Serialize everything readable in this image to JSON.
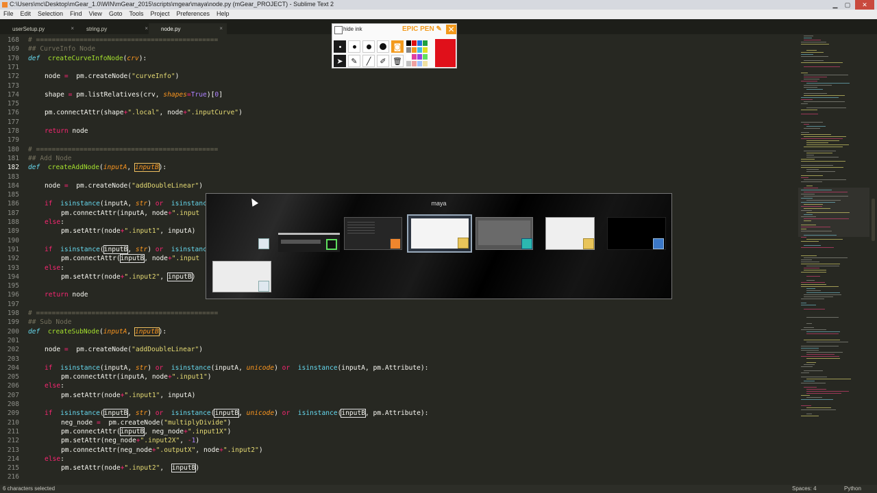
{
  "window": {
    "title": "C:\\Users\\mc\\Desktop\\mGear_1.0\\WIN\\mGear_2015\\scripts\\mgear\\maya\\node.py (mGear_PROJECT) - Sublime Text 2"
  },
  "menu": [
    "File",
    "Edit",
    "Selection",
    "Find",
    "View",
    "Goto",
    "Tools",
    "Project",
    "Preferences",
    "Help"
  ],
  "tabs": [
    {
      "label": "userSetup.py",
      "close": "×"
    },
    {
      "label": "string.py",
      "close": "×"
    },
    {
      "label": "node.py",
      "close": "×",
      "active": true
    }
  ],
  "editor": {
    "current_line": 182,
    "lines": [
      {
        "n": 168,
        "ind": 0,
        "t": [
          [
            "cm",
            "# =============================================="
          ]
        ]
      },
      {
        "n": 169,
        "ind": 0,
        "t": [
          [
            "cm",
            "## CurveInfo Node"
          ]
        ]
      },
      {
        "n": 170,
        "ind": 0,
        "t": [
          [
            "df",
            "def"
          ],
          [
            "",
            "  "
          ],
          [
            "fn",
            "createCurveInfoNode"
          ],
          [
            "",
            "("
          ],
          [
            "pa",
            "crv"
          ],
          [
            "",
            "):"
          ]
        ]
      },
      {
        "n": 171,
        "ind": 0,
        "t": []
      },
      {
        "n": 172,
        "ind": 1,
        "t": [
          [
            "",
            "node "
          ],
          [
            "kw",
            "="
          ],
          [
            "",
            "  pm.createNode("
          ],
          [
            "st",
            "\"curveInfo\""
          ],
          [
            "",
            ")"
          ]
        ]
      },
      {
        "n": 173,
        "ind": 0,
        "t": []
      },
      {
        "n": 174,
        "ind": 1,
        "t": [
          [
            "",
            "shape "
          ],
          [
            "kw",
            "="
          ],
          [
            "",
            " pm.listRelatives(crv, "
          ],
          [
            "pa",
            "shapes"
          ],
          [
            "kw",
            "="
          ],
          [
            "nu",
            "True"
          ],
          [
            "",
            ")["
          ],
          [
            "nu",
            "0"
          ],
          [
            "",
            "]"
          ]
        ]
      },
      {
        "n": 175,
        "ind": 0,
        "t": []
      },
      {
        "n": 176,
        "ind": 1,
        "t": [
          [
            "",
            "pm.connectAttr(shape"
          ],
          [
            "kw",
            "+"
          ],
          [
            "st",
            "\".local\""
          ],
          [
            "",
            ", node"
          ],
          [
            "kw",
            "+"
          ],
          [
            "st",
            "\".inputCurve\""
          ],
          [
            "",
            ")"
          ]
        ]
      },
      {
        "n": 177,
        "ind": 0,
        "t": []
      },
      {
        "n": 178,
        "ind": 1,
        "t": [
          [
            "kw",
            "return"
          ],
          [
            "",
            " node"
          ]
        ]
      },
      {
        "n": 179,
        "ind": 0,
        "t": []
      },
      {
        "n": 180,
        "ind": 0,
        "t": [
          [
            "cm",
            "# =============================================="
          ]
        ]
      },
      {
        "n": 181,
        "ind": 0,
        "t": [
          [
            "cm",
            "## Add Node"
          ]
        ]
      },
      {
        "n": 182,
        "ind": 0,
        "t": [
          [
            "df",
            "def"
          ],
          [
            "",
            "  "
          ],
          [
            "fn",
            "createAddNode"
          ],
          [
            "",
            "("
          ],
          [
            "pa",
            "inputA"
          ],
          [
            "",
            ", "
          ],
          [
            "pa bxo",
            "inputB"
          ],
          [
            "",
            "):"
          ]
        ]
      },
      {
        "n": 183,
        "ind": 0,
        "t": []
      },
      {
        "n": 184,
        "ind": 1,
        "t": [
          [
            "",
            "node "
          ],
          [
            "kw",
            "="
          ],
          [
            "",
            "  pm.createNode("
          ],
          [
            "st",
            "\"addDoubleLinear\""
          ],
          [
            "",
            ")"
          ]
        ]
      },
      {
        "n": 185,
        "ind": 0,
        "t": []
      },
      {
        "n": 186,
        "ind": 1,
        "t": [
          [
            "kw",
            "if"
          ],
          [
            "",
            "  "
          ],
          [
            "bi",
            "isinstance"
          ],
          [
            "",
            "(inputA, "
          ],
          [
            "pa",
            "str"
          ],
          [
            "",
            ") "
          ],
          [
            "kw",
            "or"
          ],
          [
            "",
            "  "
          ],
          [
            "bi",
            "isinstanc"
          ]
        ]
      },
      {
        "n": 187,
        "ind": 2,
        "t": [
          [
            "",
            "pm.connectAttr(inputA, node"
          ],
          [
            "kw",
            "+"
          ],
          [
            "st",
            "\".input"
          ]
        ]
      },
      {
        "n": 188,
        "ind": 1,
        "t": [
          [
            "kw",
            "else"
          ],
          [
            "",
            ":"
          ]
        ]
      },
      {
        "n": 189,
        "ind": 2,
        "t": [
          [
            "",
            "pm.setAttr(node"
          ],
          [
            "kw",
            "+"
          ],
          [
            "st",
            "\".input1\""
          ],
          [
            "",
            ", inputA)"
          ]
        ]
      },
      {
        "n": 190,
        "ind": 0,
        "t": []
      },
      {
        "n": 191,
        "ind": 1,
        "t": [
          [
            "kw",
            "if"
          ],
          [
            "",
            "  "
          ],
          [
            "bi",
            "isinstance"
          ],
          [
            "",
            "("
          ],
          [
            "bx",
            "inputB"
          ],
          [
            "",
            ", "
          ],
          [
            "pa",
            "str"
          ],
          [
            "",
            ") "
          ],
          [
            "kw",
            "or"
          ],
          [
            "",
            "  "
          ],
          [
            "bi",
            "isinstanc"
          ]
        ]
      },
      {
        "n": 192,
        "ind": 2,
        "t": [
          [
            "",
            "pm.connectAttr("
          ],
          [
            "bx",
            "inputB"
          ],
          [
            "",
            ", node"
          ],
          [
            "kw",
            "+"
          ],
          [
            "st",
            "\".input"
          ]
        ]
      },
      {
        "n": 193,
        "ind": 1,
        "t": [
          [
            "kw",
            "else"
          ],
          [
            "",
            ":"
          ]
        ]
      },
      {
        "n": 194,
        "ind": 2,
        "t": [
          [
            "",
            "pm.setAttr(node"
          ],
          [
            "kw",
            "+"
          ],
          [
            "st",
            "\".input2\""
          ],
          [
            "",
            ", "
          ],
          [
            "bx",
            "inputB"
          ],
          [
            "",
            ")"
          ]
        ]
      },
      {
        "n": 195,
        "ind": 0,
        "t": []
      },
      {
        "n": 196,
        "ind": 1,
        "t": [
          [
            "kw",
            "return"
          ],
          [
            "",
            " node"
          ]
        ]
      },
      {
        "n": 197,
        "ind": 0,
        "t": []
      },
      {
        "n": 198,
        "ind": 0,
        "t": [
          [
            "cm",
            "# =============================================="
          ]
        ]
      },
      {
        "n": 199,
        "ind": 0,
        "t": [
          [
            "cm",
            "## Sub Node"
          ]
        ]
      },
      {
        "n": 200,
        "ind": 0,
        "t": [
          [
            "df",
            "def"
          ],
          [
            "",
            "  "
          ],
          [
            "fn",
            "createSubNode"
          ],
          [
            "",
            "("
          ],
          [
            "pa",
            "inputA"
          ],
          [
            "",
            ", "
          ],
          [
            "pa bxo",
            "inputB"
          ],
          [
            "",
            "):"
          ]
        ]
      },
      {
        "n": 201,
        "ind": 0,
        "t": []
      },
      {
        "n": 202,
        "ind": 1,
        "t": [
          [
            "",
            "node "
          ],
          [
            "kw",
            "="
          ],
          [
            "",
            "  pm.createNode("
          ],
          [
            "st",
            "\"addDoubleLinear\""
          ],
          [
            "",
            ")"
          ]
        ]
      },
      {
        "n": 203,
        "ind": 0,
        "t": []
      },
      {
        "n": 204,
        "ind": 1,
        "t": [
          [
            "kw",
            "if"
          ],
          [
            "",
            "  "
          ],
          [
            "bi",
            "isinstance"
          ],
          [
            "",
            "(inputA, "
          ],
          [
            "pa",
            "str"
          ],
          [
            "",
            ") "
          ],
          [
            "kw",
            "or"
          ],
          [
            "",
            "  "
          ],
          [
            "bi",
            "isinstance"
          ],
          [
            "",
            "(inputA, "
          ],
          [
            "pa",
            "unicode"
          ],
          [
            "",
            ") "
          ],
          [
            "kw",
            "or"
          ],
          [
            "",
            "  "
          ],
          [
            "bi",
            "isinstance"
          ],
          [
            "",
            "(inputA, pm.Attribute):"
          ]
        ]
      },
      {
        "n": 205,
        "ind": 2,
        "t": [
          [
            "",
            "pm.connectAttr(inputA, node"
          ],
          [
            "kw",
            "+"
          ],
          [
            "st",
            "\".input1\""
          ],
          [
            "",
            ")"
          ]
        ]
      },
      {
        "n": 206,
        "ind": 1,
        "t": [
          [
            "kw",
            "else"
          ],
          [
            "",
            ":"
          ]
        ]
      },
      {
        "n": 207,
        "ind": 2,
        "t": [
          [
            "",
            "pm.setAttr(node"
          ],
          [
            "kw",
            "+"
          ],
          [
            "st",
            "\".input1\""
          ],
          [
            "",
            ", inputA)"
          ]
        ]
      },
      {
        "n": 208,
        "ind": 0,
        "t": []
      },
      {
        "n": 209,
        "ind": 1,
        "t": [
          [
            "kw",
            "if"
          ],
          [
            "",
            "  "
          ],
          [
            "bi",
            "isinstance"
          ],
          [
            "",
            "("
          ],
          [
            "bx",
            "inputB"
          ],
          [
            "",
            ", "
          ],
          [
            "pa",
            "str"
          ],
          [
            "",
            ") "
          ],
          [
            "kw",
            "or"
          ],
          [
            "",
            "  "
          ],
          [
            "bi",
            "isinstance"
          ],
          [
            "",
            "("
          ],
          [
            "bx",
            "inputB"
          ],
          [
            "",
            ", "
          ],
          [
            "pa",
            "unicode"
          ],
          [
            "",
            ") "
          ],
          [
            "kw",
            "or"
          ],
          [
            "",
            "  "
          ],
          [
            "bi",
            "isinstance"
          ],
          [
            "",
            "("
          ],
          [
            "bx",
            "inputB"
          ],
          [
            "",
            ", pm.Attribute):"
          ]
        ]
      },
      {
        "n": 210,
        "ind": 2,
        "t": [
          [
            "",
            "neg_node "
          ],
          [
            "kw",
            "="
          ],
          [
            "",
            "  pm.createNode("
          ],
          [
            "st",
            "\"multiplyDivide\""
          ],
          [
            "",
            ")"
          ]
        ]
      },
      {
        "n": 211,
        "ind": 2,
        "t": [
          [
            "",
            "pm.connectAttr("
          ],
          [
            "bx",
            "inputB"
          ],
          [
            "",
            ", neg_node"
          ],
          [
            "kw",
            "+"
          ],
          [
            "st",
            "\".input1X\""
          ],
          [
            "",
            ")"
          ]
        ]
      },
      {
        "n": 212,
        "ind": 2,
        "t": [
          [
            "",
            "pm.setAttr(neg_node"
          ],
          [
            "kw",
            "+"
          ],
          [
            "st",
            "\".input2X\""
          ],
          [
            "",
            ", "
          ],
          [
            "kw",
            "-"
          ],
          [
            "nu",
            "1"
          ],
          [
            "",
            ")"
          ]
        ]
      },
      {
        "n": 213,
        "ind": 2,
        "t": [
          [
            "",
            "pm.connectAttr(neg_node"
          ],
          [
            "kw",
            "+"
          ],
          [
            "st",
            "\".outputX\""
          ],
          [
            "",
            ", node"
          ],
          [
            "kw",
            "+"
          ],
          [
            "st",
            "\".input2\""
          ],
          [
            "",
            ")"
          ]
        ]
      },
      {
        "n": 214,
        "ind": 1,
        "t": [
          [
            "kw",
            "else"
          ],
          [
            "",
            ":"
          ]
        ]
      },
      {
        "n": 215,
        "ind": 2,
        "t": [
          [
            "",
            "pm.setAttr(node"
          ],
          [
            "kw",
            "+"
          ],
          [
            "st",
            "\".input2\""
          ],
          [
            "",
            ",  "
          ],
          [
            "bx",
            "inputB"
          ],
          [
            "",
            ")"
          ]
        ]
      },
      {
        "n": 216,
        "ind": 0,
        "t": []
      }
    ]
  },
  "epic_pen": {
    "hide_ink_label": "hide ink",
    "brand": "EPIC PEN",
    "close_glyph": "✕",
    "tool_glyphs": {
      "arrow": "➤",
      "pen": "✎",
      "marker": "╱",
      "eraser": "✐",
      "trash": "🗑",
      "camera": "◙"
    },
    "swatches": [
      "#000000",
      "#e01010",
      "#2070e0",
      "#20a040",
      "#888888",
      "#f39a1c",
      "#40c0e0",
      "#e0e020",
      "#ffffff",
      "#e040a0",
      "#a040e0",
      "#60e060",
      "#c0c0c0",
      "#f0a0a0",
      "#a0c0ff",
      "#f0e0a0"
    ],
    "current_color": "#e0101a"
  },
  "switcher": {
    "title": "maya",
    "windows": [
      "explorer-icon-window",
      "toolbar-window",
      "sublime-window",
      "maya-folder-window",
      "maya-app-window",
      "folder-window",
      "dark-window",
      "explorer-window-2"
    ]
  },
  "status": {
    "left": "6 characters selected",
    "spaces": "Spaces: 4",
    "syntax": "Python"
  }
}
